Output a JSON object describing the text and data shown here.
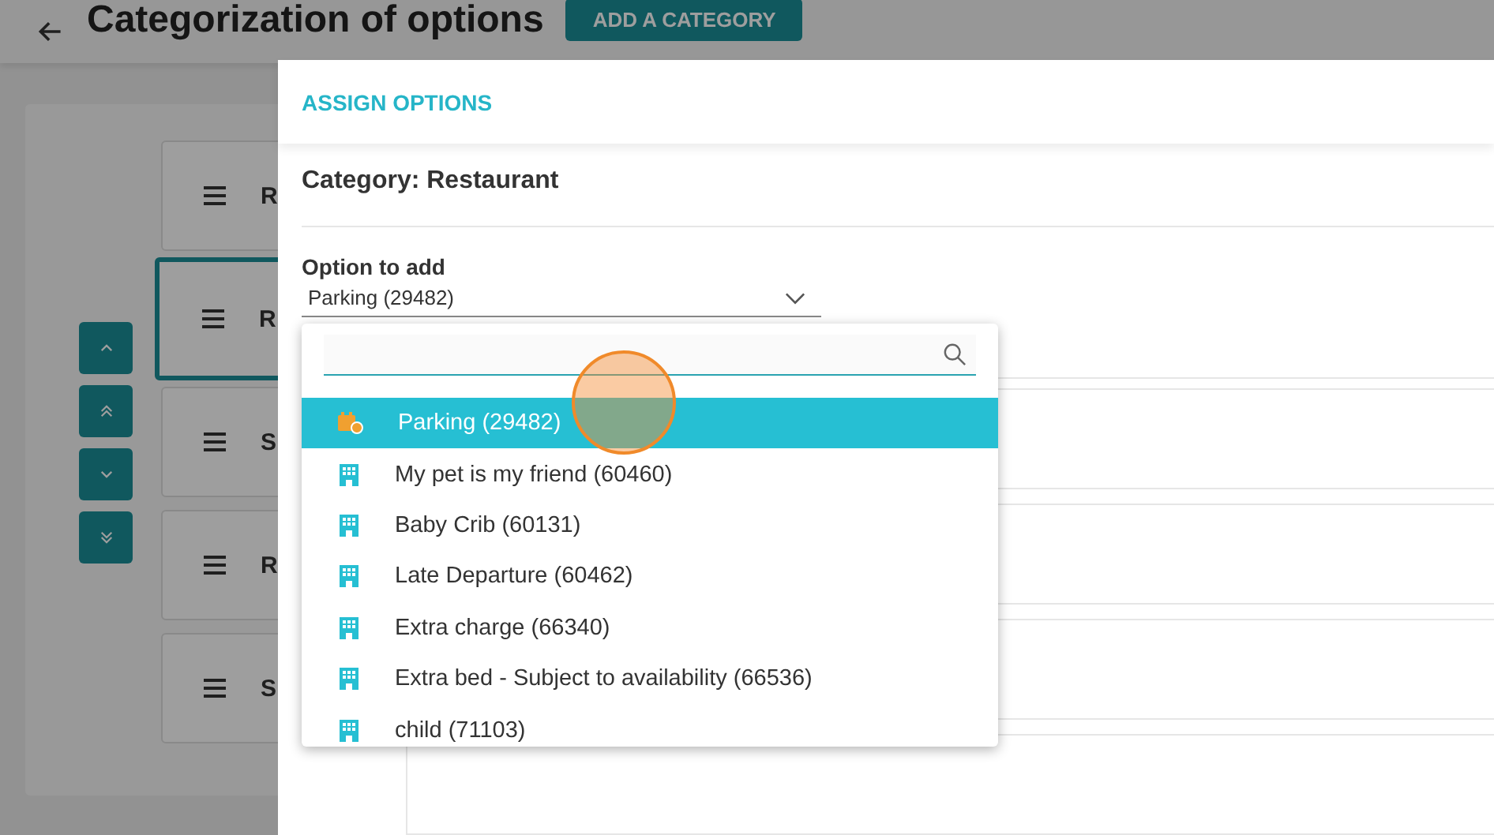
{
  "page": {
    "title": "Categorization of options",
    "add_button": "ADD A CATEGORY"
  },
  "categories": [
    {
      "label": "R",
      "selected": false
    },
    {
      "label": "R",
      "selected": true
    },
    {
      "label": "S",
      "selected": false
    },
    {
      "label": "R",
      "selected": false
    },
    {
      "label": "S",
      "selected": false
    }
  ],
  "modal": {
    "title": "ASSIGN OPTIONS",
    "category": "Category: Restaurant",
    "field": {
      "label": "Option to add",
      "value": "Parking (29482)"
    },
    "options": [
      {
        "label": "Parking (29482)",
        "kind": "calendar",
        "selected": true
      },
      {
        "label": "My pet is my friend (60460)",
        "kind": "building",
        "selected": false
      },
      {
        "label": "Baby Crib (60131)",
        "kind": "building",
        "selected": false
      },
      {
        "label": "Late Departure (60462)",
        "kind": "building",
        "selected": false
      },
      {
        "label": "Extra charge (66340)",
        "kind": "building",
        "selected": false
      },
      {
        "label": "Extra bed - Subject to availability (66536)",
        "kind": "building",
        "selected": false
      },
      {
        "label": "child (71103)",
        "kind": "building",
        "selected": false
      }
    ]
  }
}
